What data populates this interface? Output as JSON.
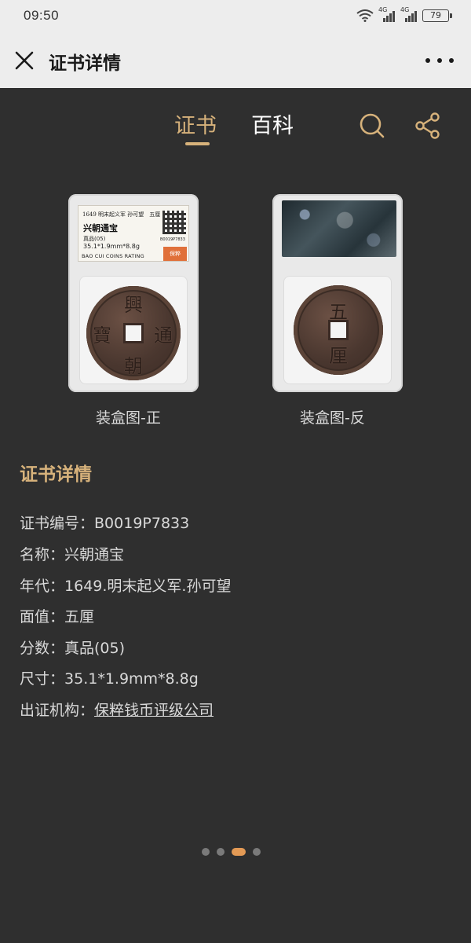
{
  "status_bar": {
    "time": "09:50",
    "signal1_label": "4G",
    "signal2_label": "4G",
    "battery": "79"
  },
  "title_bar": {
    "title": "证书详情"
  },
  "tabs": [
    {
      "label": "证书",
      "active": true
    },
    {
      "label": "百科",
      "active": false
    }
  ],
  "slabs": {
    "front": {
      "caption": "装盒图-正",
      "label_line1": "1649 明末起义军 孙可望　五厘",
      "label_name": "兴朝通宝",
      "label_grade": "真品(05)",
      "label_size": "35.1*1.9mm*8.8g",
      "label_brand": "BAO CUI COINS RATING",
      "label_id": "B0019P7833",
      "label_logo": "保粹",
      "coin_chars": [
        "興",
        "朝",
        "通",
        "寶"
      ]
    },
    "back": {
      "caption": "装盒图-反",
      "coin_chars": [
        "五",
        "厘"
      ]
    }
  },
  "details": {
    "section_title": "证书详情",
    "rows": [
      {
        "label": "证书编号：",
        "value": "B0019P7833",
        "link": false
      },
      {
        "label": "名称：",
        "value": "兴朝通宝",
        "link": false
      },
      {
        "label": "年代：",
        "value": "1649.明末起义军.孙可望",
        "link": false
      },
      {
        "label": "面值：",
        "value": "五厘",
        "link": false
      },
      {
        "label": "分数：",
        "value": "真品(05)",
        "link": false
      },
      {
        "label": "尺寸：",
        "value": "35.1*1.9mm*8.8g",
        "link": false
      },
      {
        "label": "出证机构：",
        "value": "保粹钱币评级公司",
        "link": true
      }
    ]
  },
  "pager": {
    "count": 4,
    "active_index": 2
  },
  "colors": {
    "accent": "#d7b27b",
    "background": "#2f2f2f",
    "header": "#ededed",
    "pager_active": "#e39a55"
  }
}
